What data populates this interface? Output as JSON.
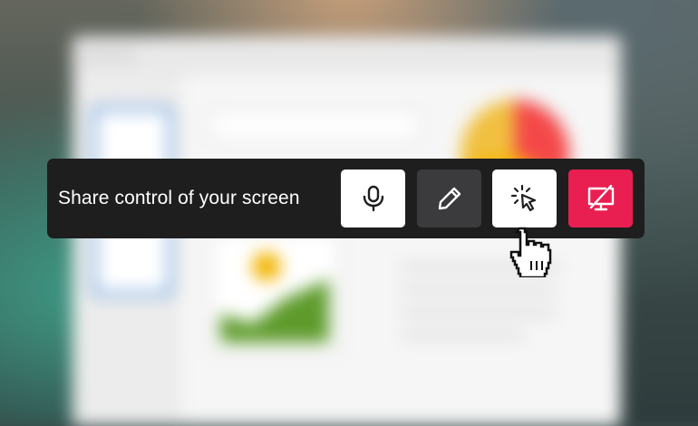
{
  "toolbar": {
    "label": "Share control of your screen",
    "buttons": [
      {
        "id": "mic",
        "icon": "microphone-icon",
        "bg": "#ffffff"
      },
      {
        "id": "draw",
        "icon": "pencil-icon",
        "bg": "#3b3b3d"
      },
      {
        "id": "share-control",
        "icon": "cursor-click-icon",
        "bg": "#ffffff"
      },
      {
        "id": "stop-sharing",
        "icon": "screen-share-off-icon",
        "bg": "#e91f52"
      }
    ]
  },
  "cursor": {
    "icon": "hand-pointer-icon"
  },
  "colors": {
    "toolbar_bg": "#1e1e1f",
    "stop_red": "#e91f52",
    "accent_blue": "#3f86d8"
  }
}
